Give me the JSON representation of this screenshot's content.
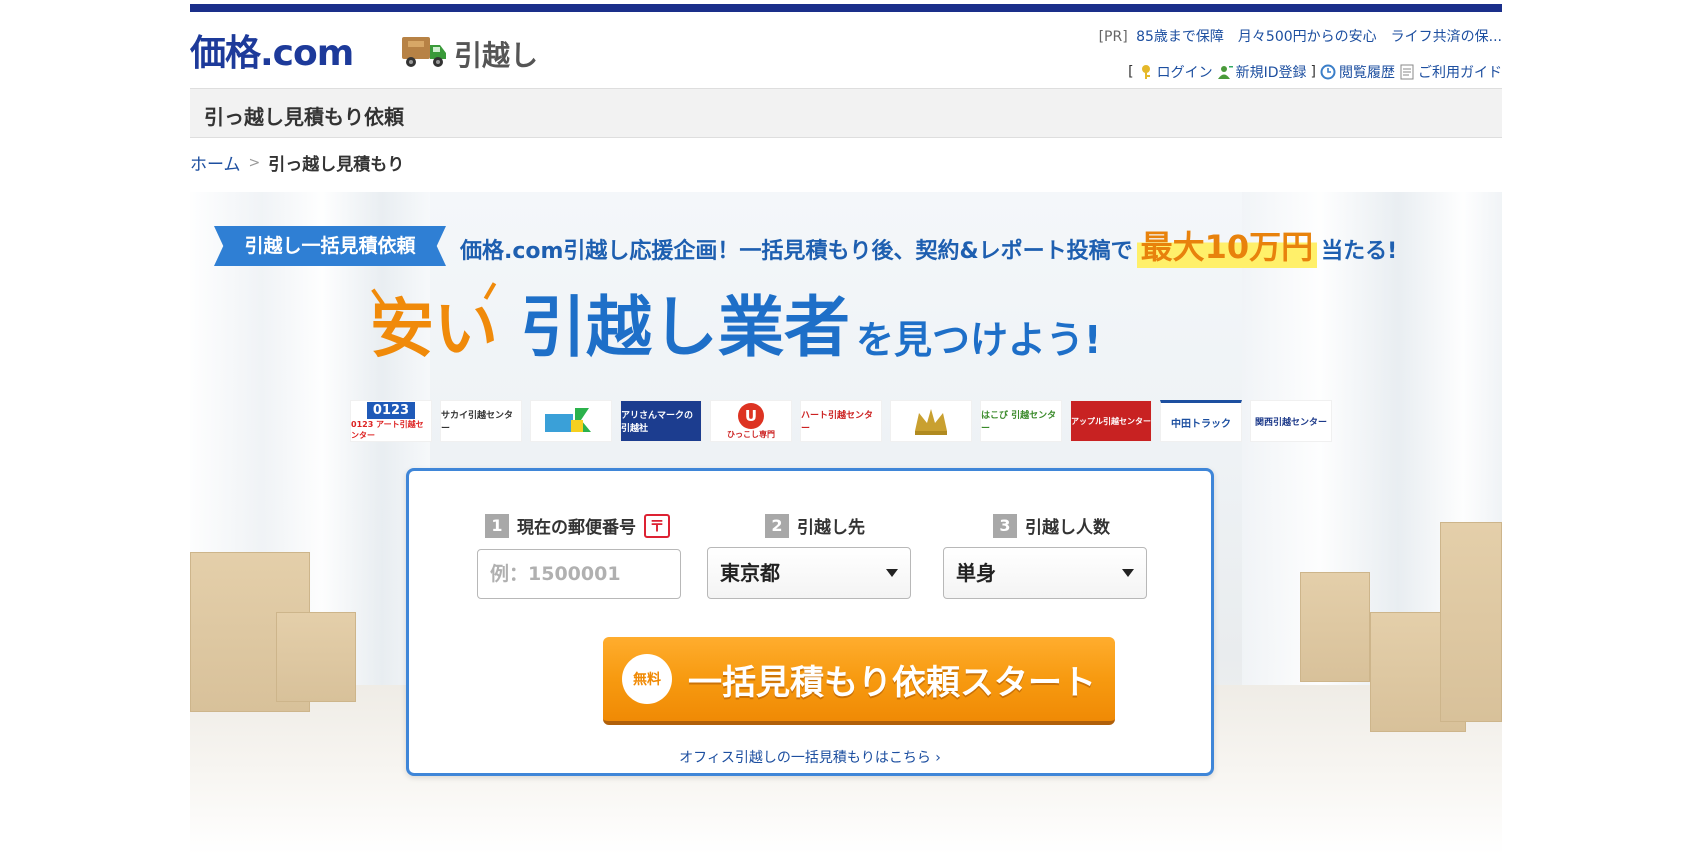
{
  "header": {
    "logo_text": "価格.com",
    "logo_sub": "引越し",
    "pr_tag": "[PR]",
    "pr_text": "85歳まで保障　月々500円からの安心　ライフ共済の保...",
    "links": {
      "open_bracket": "[",
      "login": "ログイン",
      "register": "新規ID登録",
      "close_bracket": "]",
      "history": "閲覧履歴",
      "guide": "ご利用ガイド"
    }
  },
  "page_title": "引っ越し見積もり依頼",
  "breadcrumb": {
    "home": "ホーム",
    "sep": ">",
    "current": "引っ越し見積もり"
  },
  "hero": {
    "badge": "引越し一括見積依頼",
    "campaign_pre": "価格.com引越し応援企画！一括見積もり後、契約&レポート投稿で",
    "campaign_highlight": "最大10万円",
    "campaign_post": "当たる!",
    "headline_cheap": "安い",
    "headline_main": "引越し業者",
    "headline_tail": "を見つけよう!",
    "movers": [
      "0123 アート引越センター",
      "サカイ引越センター",
      "",
      "アリさんマークの引越社",
      "ひっこし専門",
      "ハート引越センター",
      "",
      "はこび 引越センター",
      "アップル引越センター",
      "中田トラック",
      "関西引越センター"
    ]
  },
  "form": {
    "step1_num": "1",
    "step1_label": "現在の郵便番号",
    "postal_mark": "〒",
    "zip_placeholder": "例：1500001",
    "step2_num": "2",
    "step2_label": "引越し先",
    "destination_value": "東京都",
    "step3_num": "3",
    "step3_label": "引越し人数",
    "people_value": "単身",
    "cta_free": "無料",
    "cta_label": "一括見積もり依頼スタート",
    "office_link": "オフィス引越しの一括見積もりはこちら ›"
  },
  "colors": {
    "brand_navy": "#1a2f8a",
    "link_blue": "#1d4fa0",
    "accent_orange": "#f08a05",
    "card_border": "#3f86d8"
  }
}
